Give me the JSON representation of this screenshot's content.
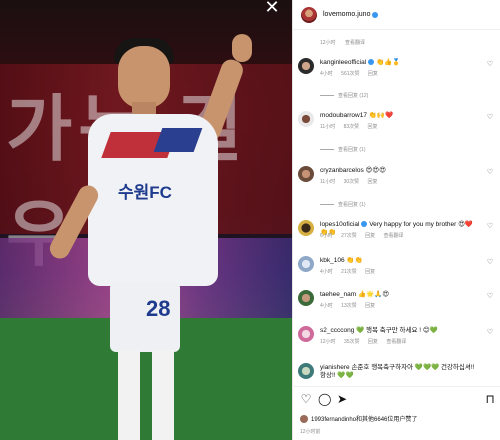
{
  "post": {
    "username": "lovemomo.juno",
    "caption_time": "12小时",
    "caption_translate": "查看翻译"
  },
  "photo": {
    "banner_text": "가는 걸 우",
    "shirt_text": "수원FC",
    "shorts_number": "28"
  },
  "comments": [
    {
      "username": "kanginleeofficial",
      "text": "👏👍🥇",
      "time": "4小时",
      "likes": "561次赞",
      "reply": "回复",
      "replies": "查看回复 (12)"
    },
    {
      "username": "modoubarrow17",
      "text": "👏🙌❤️",
      "time": "11小时",
      "likes": "83次赞",
      "reply": "回复",
      "replies": "查看回复 (1)"
    },
    {
      "username": "cryzanbarcelos",
      "text": "😍😍😍",
      "time": "11小时",
      "likes": "30次赞",
      "reply": "回复",
      "replies": "查看回复 (1)"
    },
    {
      "username": "lopes10oficial",
      "text": "Very happy for you my brother 😍❤️👏👏",
      "time": "6小时",
      "likes": "27次赞",
      "reply": "回复",
      "translate": "查看翻译"
    },
    {
      "username": "kbk_106",
      "text": "👏👏",
      "time": "4小时",
      "likes": "21次赞",
      "reply": "回复"
    },
    {
      "username": "taehee_nam",
      "text": "👍🌟🙏😍",
      "time": "4小时",
      "likes": "13次赞",
      "reply": "回复"
    },
    {
      "username": "s2_ccccong",
      "text": "💚 행복 축구만 하세요 ! 😊💚",
      "time": "12小时",
      "likes": "35次赞",
      "reply": "回复",
      "translate": "查看翻译"
    },
    {
      "username": "yianishere",
      "text": "손준호 행복축구하자아 💚💚💚 건강하십셔!! 항상!! 💚💚",
      "time": "",
      "likes": "",
      "reply": ""
    }
  ],
  "footer": {
    "liked_by": "1993fernandinho和其他6646位用户赞了",
    "time": "12小时前"
  },
  "icons": [
    "close-icon",
    "heart-icon",
    "comment-icon",
    "share-icon",
    "bookmark-icon",
    "verified-icon"
  ],
  "colors": {
    "accent": "#3897f0",
    "muted": "#8e8e8e",
    "panel_bg": "#ffffff"
  }
}
